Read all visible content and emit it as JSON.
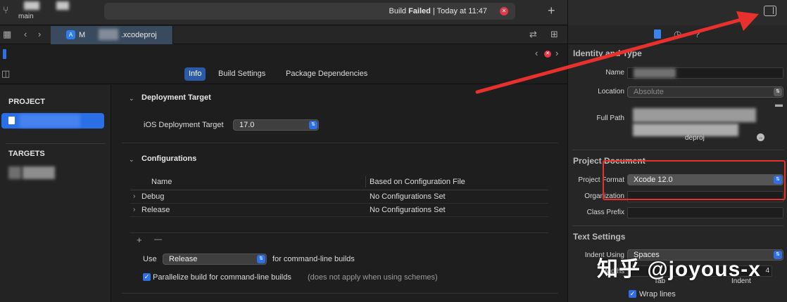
{
  "toolbar": {
    "branch": "main",
    "build_status_prefix": "Build ",
    "build_status_bold": "Failed",
    "build_status_suffix": " | Today at 11:47"
  },
  "tab": {
    "name_prefix": "M",
    "name_suffix": ".xcodeproj"
  },
  "editor_tabs": [
    "Info",
    "Build Settings",
    "Package Dependencies"
  ],
  "sidebar": {
    "project_header": "PROJECT",
    "targets_header": "TARGETS"
  },
  "deployment": {
    "title": "Deployment Target",
    "label": "iOS Deployment Target",
    "value": "17.0"
  },
  "configurations": {
    "title": "Configurations",
    "columns": [
      "Name",
      "Based on Configuration File"
    ],
    "rows": [
      {
        "name": "Debug",
        "file": "No Configurations Set"
      },
      {
        "name": "Release",
        "file": "No Configurations Set"
      }
    ],
    "add_symbol": "+",
    "remove_symbol": "—",
    "use_label": "Use",
    "use_value": "Release",
    "use_suffix": "for command-line builds",
    "parallelize_label": "Parallelize build for command-line builds",
    "parallelize_note": "(does not apply when using schemes)"
  },
  "inspector": {
    "identity_header": "Identity and Type",
    "name_label": "Name",
    "location_label": "Location",
    "location_value": "Absolute",
    "fullpath_label": "Full Path",
    "fullpath_suffix": "deproj",
    "project_document_header": "Project Document",
    "format_label": "Project Format",
    "format_value": "Xcode 12.0",
    "organization_label": "Organization",
    "class_prefix_label": "Class Prefix",
    "text_settings_header": "Text Settings",
    "indent_using_label": "Indent Using",
    "indent_using_value": "Spaces",
    "widths_label": "Widths",
    "tab_label": "Tab",
    "indent_label": "Indent",
    "indent_value": "4",
    "wrap_lines_label": "Wrap lines"
  },
  "watermark": "知乎 @joyous-x",
  "colors": {
    "accent": "#2b6fe6",
    "error": "#e0394a",
    "annotation": "#e8312c"
  }
}
